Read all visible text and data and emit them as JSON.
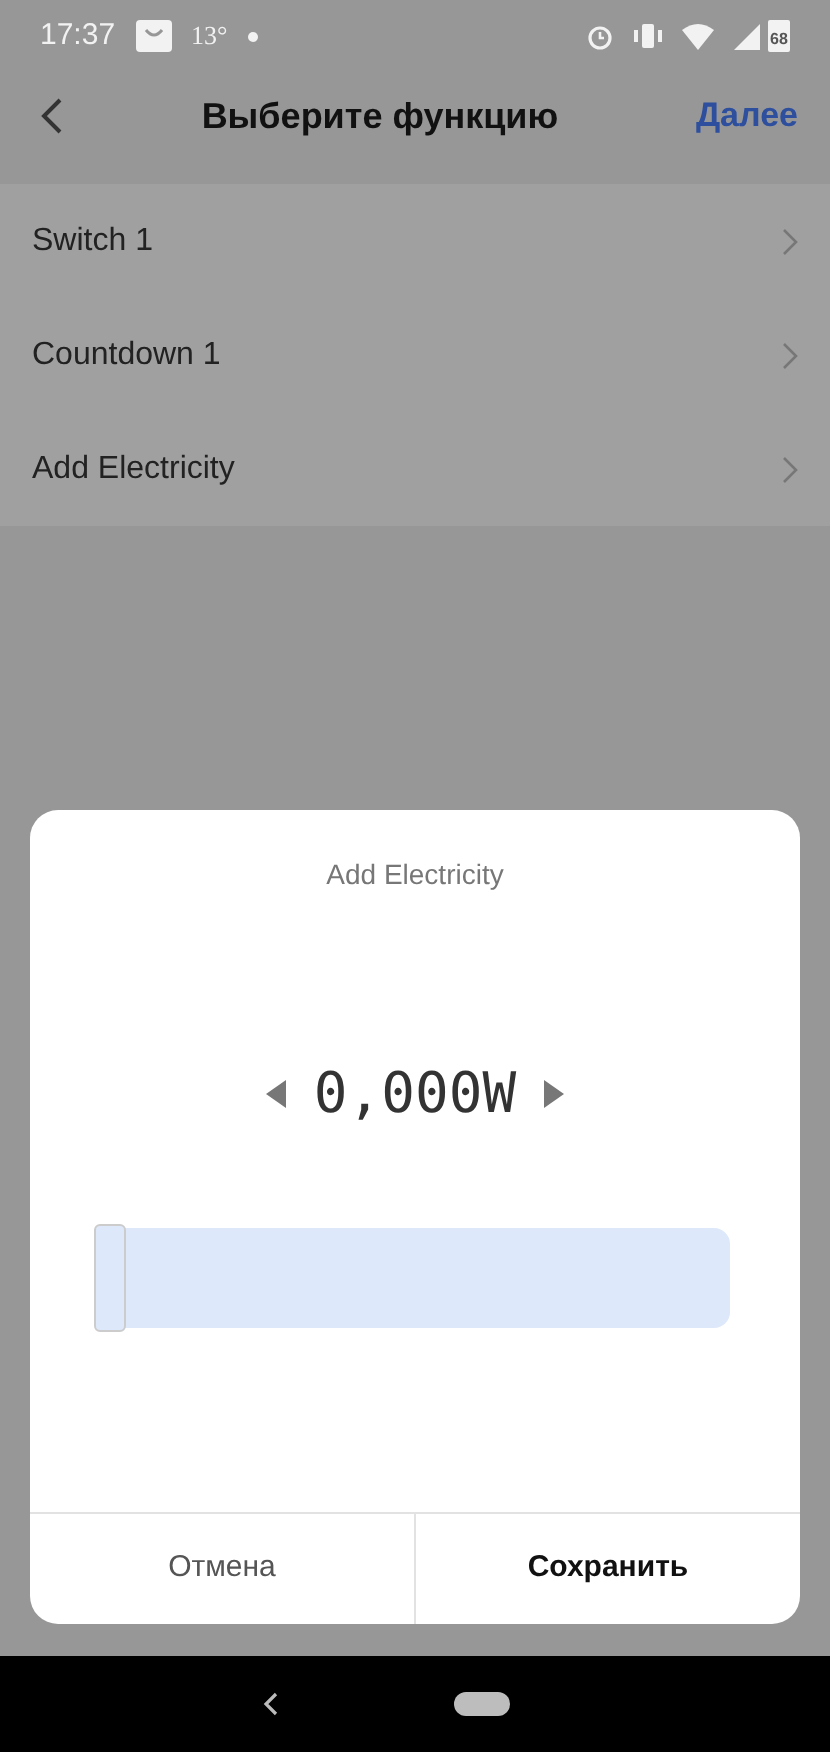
{
  "status_bar": {
    "time": "17:37",
    "temperature": "13°",
    "battery": "68"
  },
  "header": {
    "title": "Выберите функцию",
    "action": "Далее"
  },
  "functions": [
    {
      "label": "Switch 1"
    },
    {
      "label": "Countdown 1"
    },
    {
      "label": "Add Electricity"
    }
  ],
  "dialog": {
    "title": "Add Electricity",
    "value": "0,000W",
    "slider": {
      "level": 0
    },
    "buttons": [
      {
        "label": "Отмена",
        "primary": false
      },
      {
        "label": "Сохранить",
        "primary": true
      }
    ]
  }
}
